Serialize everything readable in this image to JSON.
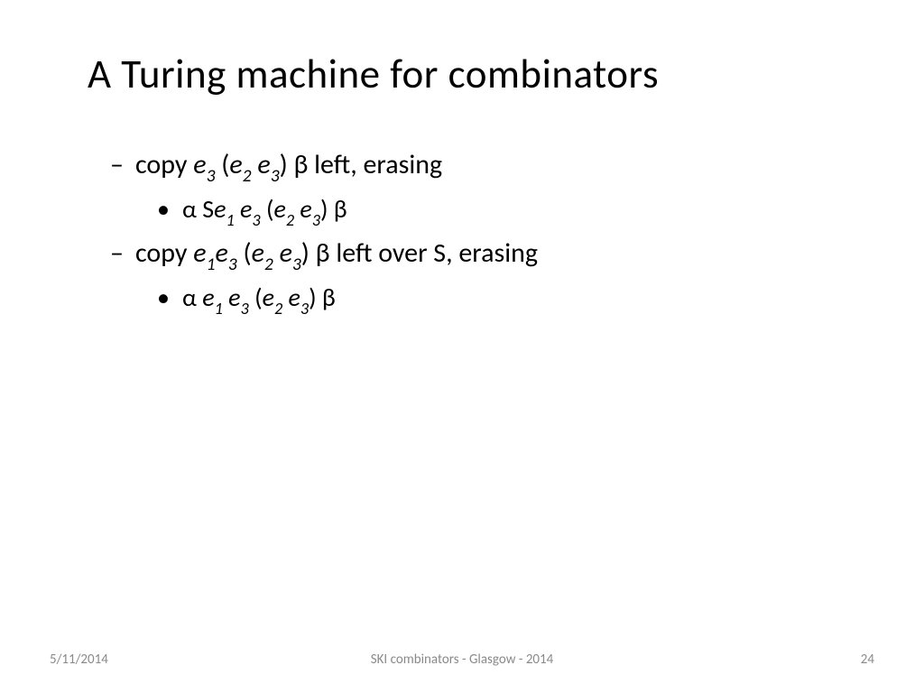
{
  "title": "A Turing machine for combinators",
  "lines": {
    "dash1_prefix": "copy ",
    "dash1_suffix": ") β left, erasing",
    "bullet1_prefix": "α S",
    "bullet1_suffix": ") β",
    "dash2_prefix": "copy ",
    "dash2_suffix": ") β left over S, erasing",
    "bullet2_prefix": "α ",
    "bullet2_suffix": ") β",
    "e": "e",
    "s1": "1",
    "s2": "2",
    "s3": "3",
    "lparen": " (",
    "space": " "
  },
  "footer": {
    "date": "5/11/2014",
    "center": "SKI combinators - Glasgow - 2014",
    "page": "24"
  }
}
